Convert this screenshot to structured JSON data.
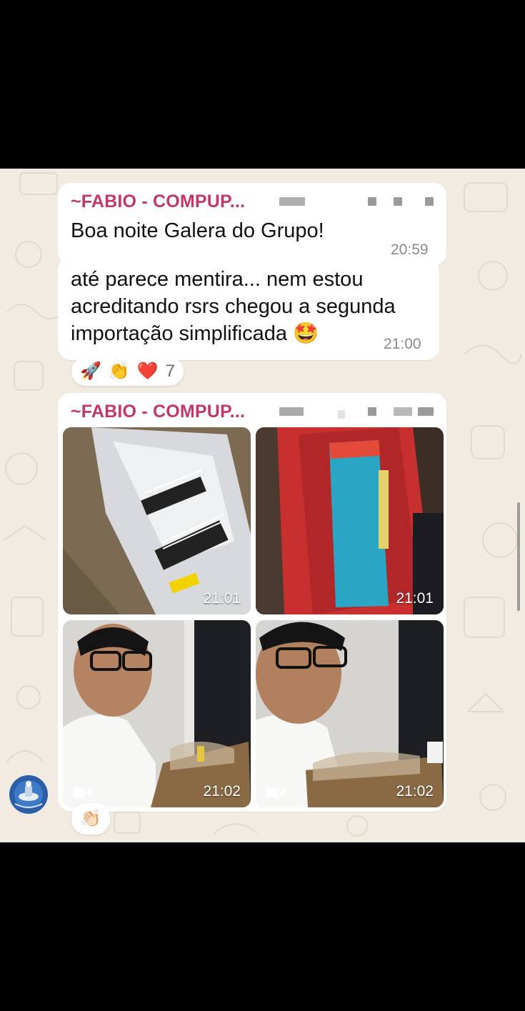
{
  "messages": [
    {
      "sender": "~FABIO - COMPUP...",
      "text": "Boa noite Galera do Grupo!",
      "time": "20:59"
    },
    {
      "text": "até parece mentira... nem estou\nacreditando rsrs chegou a segunda\nimportação simplificada 🤩",
      "time": "21:00",
      "reactions": {
        "emojis": [
          "🚀",
          "👏",
          "❤️"
        ],
        "count": "7"
      }
    },
    {
      "sender": "~FABIO - COMPUP...",
      "media": [
        {
          "type": "photo",
          "subject": "shipping package with barcode label",
          "time": "21:01"
        },
        {
          "type": "photo",
          "subject": "blue graphics card in red anti-static bag",
          "time": "21:01"
        },
        {
          "type": "video",
          "subject": "man with glasses opening package",
          "time": "21:02",
          "icon": "video-camera-icon"
        },
        {
          "type": "video",
          "subject": "man with glasses opening package",
          "time": "21:02",
          "icon": "video-camera-icon"
        }
      ],
      "reaction": "👏🏻"
    }
  ],
  "colors": {
    "sender": "#c2376b",
    "chat_background": "#f1ebe2",
    "bubble": "#ffffff"
  }
}
